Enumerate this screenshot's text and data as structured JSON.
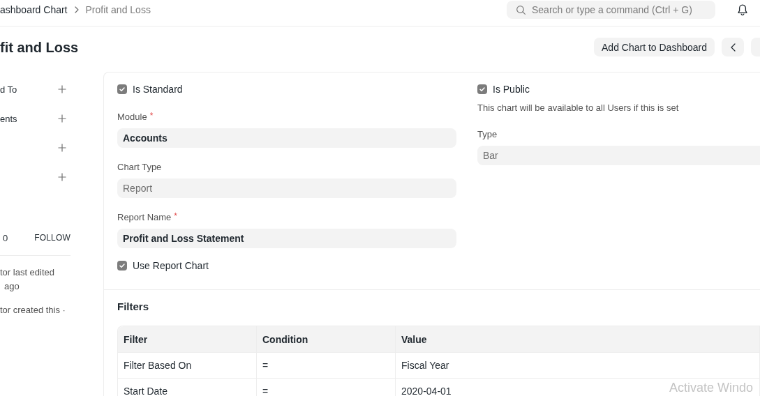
{
  "breadcrumbs": [
    {
      "label": "ashboard Chart",
      "current": false
    },
    {
      "label": "Profit and Loss",
      "current": true
    }
  ],
  "search": {
    "placeholder": "Search or type a command (Ctrl + G)"
  },
  "page_title": "fit and Loss",
  "actions": [
    {
      "kind": "text",
      "label": "Add Chart to Dashboard"
    },
    {
      "kind": "prev"
    },
    {
      "kind": "stub"
    }
  ],
  "sidebar": {
    "items": [
      {
        "kind": "add",
        "label": "d To"
      },
      {
        "kind": "add",
        "label": "ents"
      },
      {
        "kind": "add"
      },
      {
        "kind": "add"
      }
    ],
    "follow": {
      "count": "0",
      "action": "FOLLOW"
    },
    "activity": [
      "tor last edited",
      "ago",
      "tor created this ·"
    ]
  },
  "form": {
    "columns": [
      [
        {
          "kind": "check",
          "label": "Is Standard",
          "checked": true
        },
        {
          "kind": "link",
          "label": "Module",
          "required_mark": "*",
          "value": "Accounts"
        },
        {
          "kind": "select",
          "label": "Chart Type",
          "value": "Report"
        },
        {
          "kind": "link",
          "label": "Report Name",
          "required_mark": "*",
          "value": "Profit and Loss Statement"
        },
        {
          "kind": "check",
          "label": "Use Report Chart",
          "checked": true
        }
      ],
      [
        {
          "kind": "check",
          "label": "Is Public",
          "checked": true
        },
        {
          "kind": "description",
          "text": "This chart will be available to all Users if this is set"
        },
        {
          "kind": "select",
          "label": "Type",
          "value": "Bar"
        }
      ]
    ]
  },
  "filters": {
    "title": "Filters",
    "columns": [
      "Filter",
      "Condition",
      "Value"
    ],
    "rows": [
      [
        "Filter Based On",
        "=",
        "Fiscal Year"
      ],
      [
        "Start Date",
        "=",
        "2020-04-01"
      ]
    ]
  },
  "os_notice": "Activate Windo"
}
